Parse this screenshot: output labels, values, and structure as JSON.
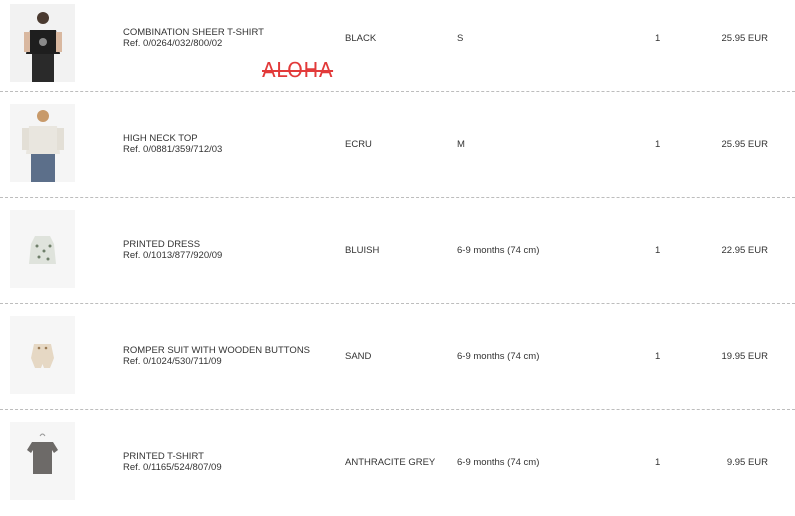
{
  "overlay": {
    "stamp_text": "ALOHA"
  },
  "items": [
    {
      "name": "COMBINATION SHEER T-SHIRT",
      "ref": "Ref. 0/0264/032/800/02",
      "color": "BLACK",
      "size": "S",
      "quantity": "1",
      "price": "25.95 EUR",
      "image_icon": "woman-black-sheer-tshirt-photo"
    },
    {
      "name": "HIGH NECK TOP",
      "ref": "Ref. 0/0881/359/712/03",
      "color": "ECRU",
      "size": "M",
      "quantity": "1",
      "price": "25.95 EUR",
      "image_icon": "woman-ecru-high-neck-top-photo"
    },
    {
      "name": "PRINTED DRESS",
      "ref": "Ref. 0/1013/877/920/09",
      "color": "BLUISH",
      "size": "6-9 months (74 cm)",
      "quantity": "1",
      "price": "22.95 EUR",
      "image_icon": "baby-printed-dress-photo"
    },
    {
      "name": "ROMPER SUIT WITH WOODEN BUTTONS",
      "ref": "Ref. 0/1024/530/711/09",
      "color": "SAND",
      "size": "6-9 months (74 cm)",
      "quantity": "1",
      "price": "19.95 EUR",
      "image_icon": "baby-sand-romper-photo"
    },
    {
      "name": "PRINTED T-SHIRT",
      "ref": "Ref. 0/1165/524/807/09",
      "color": "ANTHRACITE GREY",
      "size": "6-9 months (74 cm)",
      "quantity": "1",
      "price": "9.95 EUR",
      "image_icon": "baby-grey-printed-tshirt-photo"
    }
  ],
  "colors": {
    "stamp": "#e23a3a",
    "divider": "#bdbdbd",
    "text": "#333333"
  }
}
